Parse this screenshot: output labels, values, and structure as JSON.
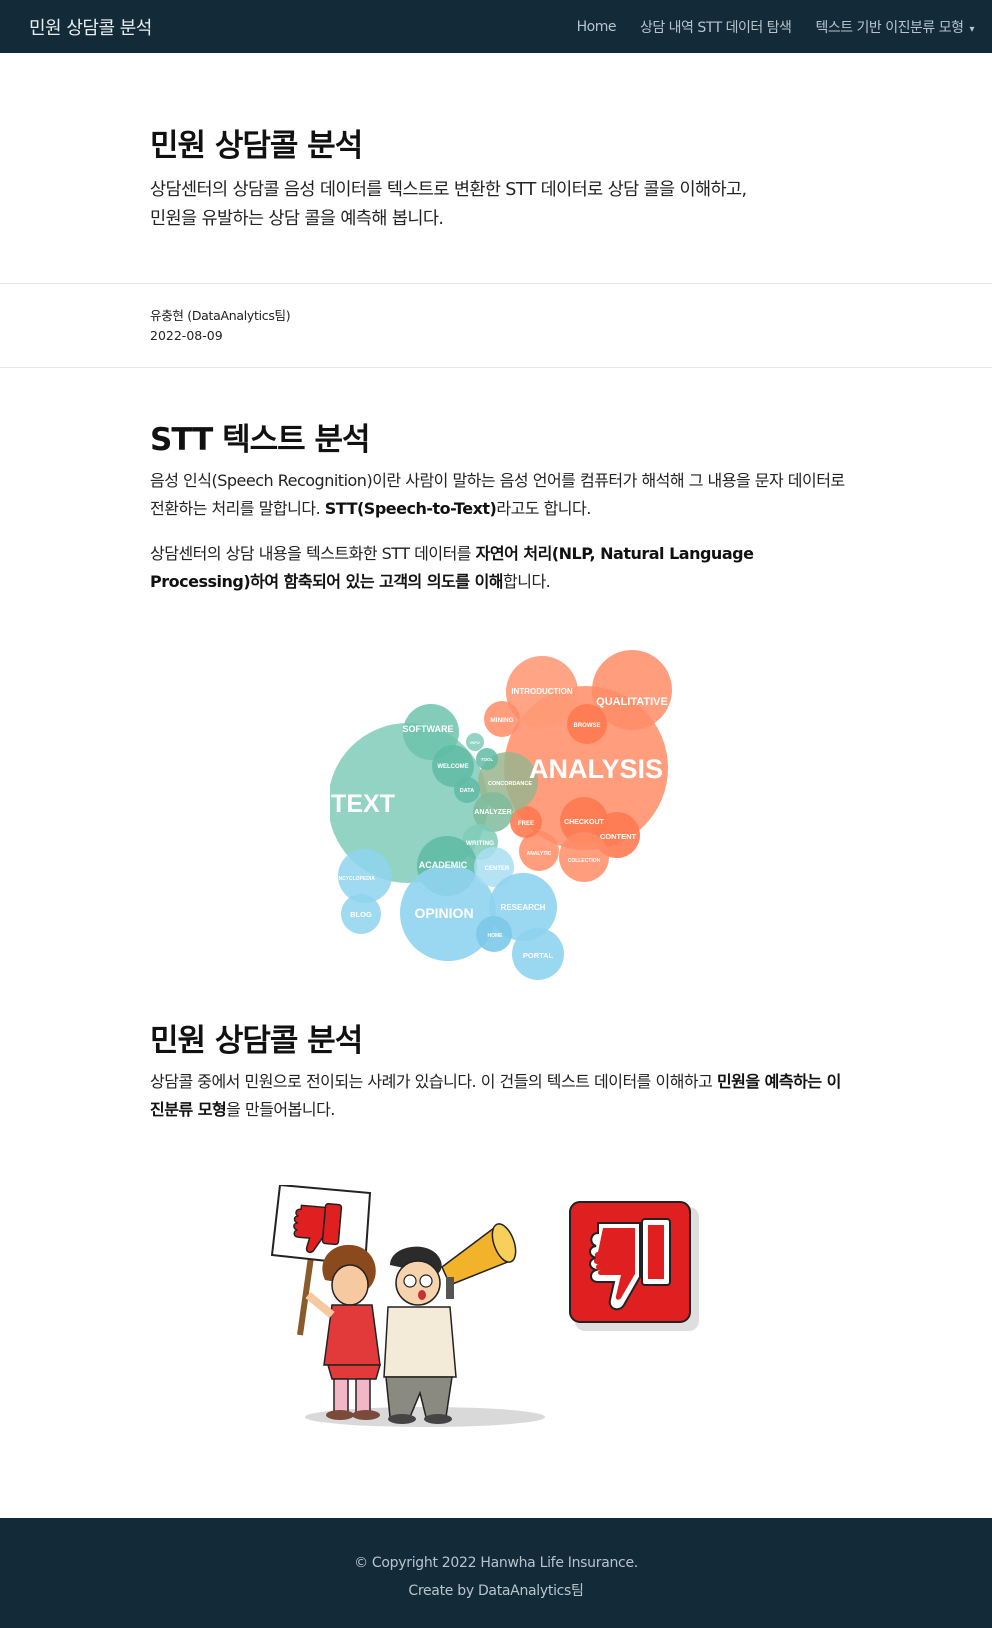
{
  "navbar": {
    "brand": "민원 상담콜 분석",
    "links": [
      {
        "label": "Home"
      },
      {
        "label": "상담 내역 STT 데이터 탐색"
      },
      {
        "label": "텍스트 기반 이진분류 모형"
      }
    ],
    "dropdown_caret": "▾"
  },
  "hero": {
    "title": "민원 상담콜 분석",
    "subtitle_line1": "상담센터의 상담콜 음성 데이터를 텍스트로 변환한 STT 데이터로 상담 콜을 이해하고,",
    "subtitle_line2": "민원을 유발하는 상담 콜을 예측해 봅니다."
  },
  "meta": {
    "author": "유충현 (DataAnalytics팀)",
    "date": "2022-08-09"
  },
  "section1": {
    "title": "STT 텍스트 분석",
    "p1_text": "음성 인식(Speech Recognition)이란 사람이 말하는 음성 언어를 컴퓨터가 해석해 그 내용을 문자 데이터로 전환하는 처리를 말합니다. ",
    "p1_bold": "STT(Speech-to-Text)",
    "p1_tail": "라고도 합니다.",
    "p2_text": "상담센터의 상담 내용을 텍스트화한 STT 데이터를 ",
    "p2_bold": "자연어 처리(NLP, Natural Language Processing)하여 함축되어 있는 고객의 의도를 이해",
    "p2_tail": "합니다."
  },
  "bubble_chart": {
    "words": [
      "TEXT",
      "ANALYSIS",
      "OPINION",
      "QUALITATIVE",
      "INTRODUCTION",
      "SOFTWARE",
      "ACADEMIC",
      "RESEARCH",
      "PORTAL",
      "BLOG",
      "ENCYCLOPEDIA",
      "WELCOME",
      "CONCORDANCE",
      "ANALYZER",
      "WRITING",
      "CENTER",
      "HOME",
      "MINING",
      "BROWSE",
      "CHECKOUT",
      "CONTENT",
      "COLLECTION",
      "ANALYTIC",
      "FREE",
      "DATA",
      "TOOL",
      "INFO"
    ]
  },
  "section2": {
    "title": "민원 상담콜 분석",
    "p1_text": "상담콜 중에서 민원으로 전이되는 사례가 있습니다. 이 건들의 텍스트 데이터를 이해하고 ",
    "p1_bold": "민원을 예측하는 이진분류 모형",
    "p1_tail": "을 만들어봅니다."
  },
  "footer": {
    "line1": "© Copyright 2022 Hanwha Life Insurance.",
    "line2": "Create by DataAnalytics팀"
  },
  "colors": {
    "navbar_bg": "#132a39",
    "teal": "#7fcbb8",
    "orange": "#ff8c66",
    "blue": "#8fd3ee",
    "thumb_red": "#e02020"
  }
}
